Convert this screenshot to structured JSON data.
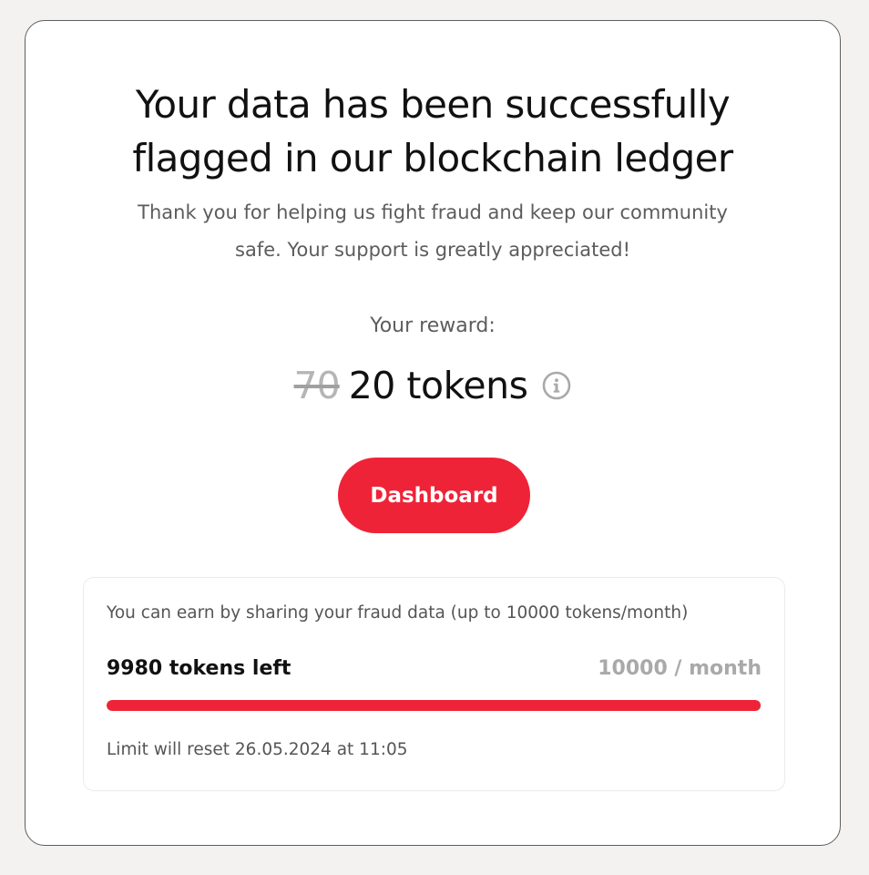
{
  "header": {
    "title_line1": "Your data has been successfully",
    "title_line2": "flagged in our blockchain ledger",
    "subtitle_line1": "Thank you for helping us fight fraud and keep our community",
    "subtitle_line2": "safe. Your support is greatly appreciated!"
  },
  "reward": {
    "label": "Your reward:",
    "old_value": "70",
    "new_value": "20 tokens",
    "info_icon": "info-circle-icon"
  },
  "actions": {
    "dashboard_label": "Dashboard"
  },
  "limit": {
    "description": "You can earn by sharing your fraud data (up to 10000 tokens/month)",
    "tokens_left_label": "9980 tokens left",
    "total_label": "10000 / month",
    "remaining": 9980,
    "total": 10000,
    "reset_text": "Limit will reset 26.05.2024 at 11:05"
  },
  "colors": {
    "accent": "#ef2337",
    "background": "#f3f2f0",
    "card": "#ffffff",
    "muted_text": "#5c5c5c",
    "disabled_text": "#a9a9a9"
  }
}
